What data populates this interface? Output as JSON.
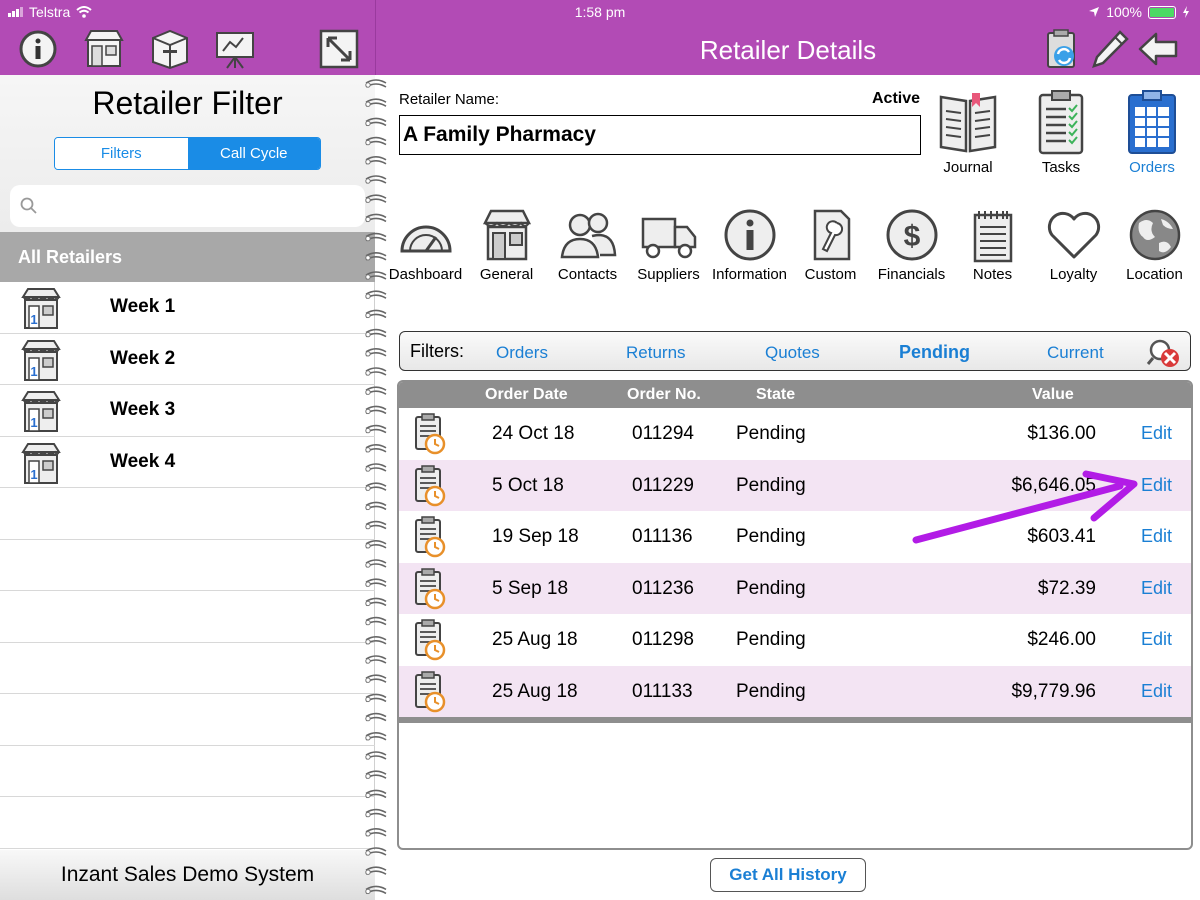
{
  "status_bar": {
    "carrier": "Telstra",
    "time": "1:58 pm",
    "battery": "100%"
  },
  "header": {
    "title": "Retailer Details"
  },
  "left": {
    "title": "Retailer Filter",
    "segments": [
      {
        "label": "Filters",
        "active": false
      },
      {
        "label": "Call Cycle",
        "active": true
      }
    ],
    "search_placeholder": "",
    "section": "All Retailers",
    "items": [
      {
        "label": "Week 1"
      },
      {
        "label": "Week 2"
      },
      {
        "label": "Week 3"
      },
      {
        "label": "Week 4"
      }
    ],
    "footer": "Inzant Sales Demo System"
  },
  "retailer": {
    "name_label": "Retailer Name:",
    "name": "A Family Pharmacy",
    "status": "Active"
  },
  "actions": [
    {
      "label": "Journal"
    },
    {
      "label": "Tasks"
    },
    {
      "label": "Orders",
      "active": true
    }
  ],
  "nav": [
    {
      "label": "Dashboard"
    },
    {
      "label": "General"
    },
    {
      "label": "Contacts"
    },
    {
      "label": "Suppliers"
    },
    {
      "label": "Information"
    },
    {
      "label": "Custom"
    },
    {
      "label": "Financials"
    },
    {
      "label": "Notes"
    },
    {
      "label": "Loyalty"
    },
    {
      "label": "Location"
    }
  ],
  "filters": {
    "label": "Filters:",
    "tabs": [
      {
        "label": "Orders"
      },
      {
        "label": "Returns"
      },
      {
        "label": "Quotes"
      },
      {
        "label": "Pending",
        "active": true
      },
      {
        "label": "Current"
      }
    ]
  },
  "table": {
    "columns": [
      "Order Date",
      "Order No.",
      "State",
      "Value"
    ],
    "rows": [
      {
        "date": "24 Oct 18",
        "no": "011294",
        "state": "Pending",
        "value": "$136.00",
        "action": "Edit"
      },
      {
        "date": "5 Oct 18",
        "no": "011229",
        "state": "Pending",
        "value": "$6,646.05",
        "action": "Edit"
      },
      {
        "date": "19 Sep 18",
        "no": "011136",
        "state": "Pending",
        "value": "$603.41",
        "action": "Edit"
      },
      {
        "date": "5 Sep 18",
        "no": "011236",
        "state": "Pending",
        "value": "$72.39",
        "action": "Edit"
      },
      {
        "date": "25 Aug 18",
        "no": "011298",
        "state": "Pending",
        "value": "$246.00",
        "action": "Edit"
      },
      {
        "date": "25 Aug 18",
        "no": "011133",
        "state": "Pending",
        "value": "$9,779.96",
        "action": "Edit"
      }
    ]
  },
  "history_button": "Get All History",
  "colors": {
    "header": "#b24bb5",
    "accent": "#1a7fd4",
    "row_alt": "#f3e4f3",
    "annotation_arrow": "#b21ce6"
  }
}
